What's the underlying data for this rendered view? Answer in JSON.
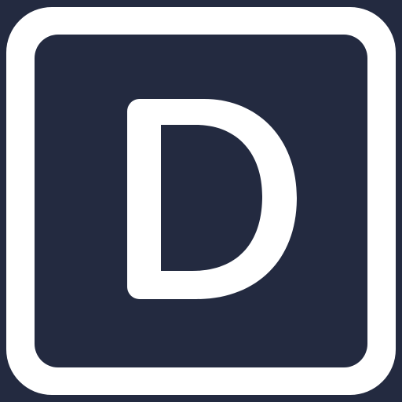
{
  "app_icon": {
    "letter": "D",
    "icon_name": "letter-d-app-icon",
    "colors": {
      "background": "#232a40",
      "border": "#ffffff",
      "letter": "#ffffff"
    }
  }
}
